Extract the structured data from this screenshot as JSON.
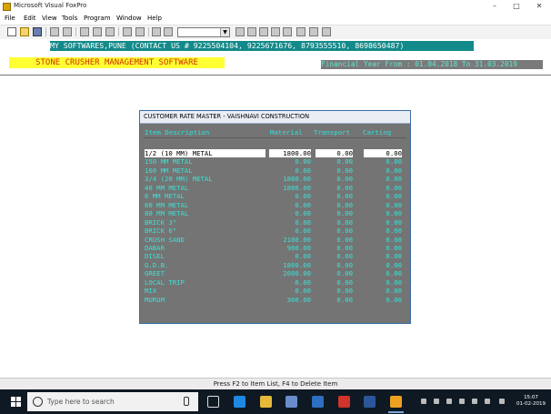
{
  "window": {
    "title": "Microsoft Visual FoxPro",
    "minimize": "–",
    "maximize": "□",
    "close": "✕"
  },
  "menu": [
    "File",
    "Edit",
    "View",
    "Tools",
    "Program",
    "Window",
    "Help"
  ],
  "header": {
    "contact": "MY SOFTWARES,PUNE (CONTACT US # 9225504104, 9225671676, 8793555510, 8698650487)",
    "app_name": "STONE CRUSHER MANAGEMENT SOFTWARE",
    "financial_year": "Financial Year From : 01.04.2018 To 31.03.2019"
  },
  "dialog": {
    "title": "CUSTOMER RATE MASTER - VAISHNAVI CONSTRUCTION",
    "columns": [
      "Item Description",
      "Material",
      "Transport",
      "Carting"
    ],
    "rows": [
      [
        "1/2 (10 MM) METAL",
        "1800.00",
        "0.00",
        "0.00"
      ],
      [
        "150 MM METAL",
        "0.00",
        "0.00",
        "0.00"
      ],
      [
        "160 MM METAL",
        "0.00",
        "0.00",
        "0.00"
      ],
      [
        "3/4 (20 MM) METAL",
        "1800.00",
        "0.00",
        "0.00"
      ],
      [
        "40 MM METAL",
        "1800.00",
        "0.00",
        "0.00"
      ],
      [
        "6 MM METAL",
        "0.00",
        "0.00",
        "0.00"
      ],
      [
        "60 MM METAL",
        "0.00",
        "0.00",
        "0.00"
      ],
      [
        "80 MM METAL",
        "0.00",
        "0.00",
        "0.00"
      ],
      [
        "BRICK 3\"",
        "0.00",
        "0.00",
        "0.00"
      ],
      [
        "BRICK 6\"",
        "0.00",
        "0.00",
        "0.00"
      ],
      [
        "CRUSH SAND",
        "2100.00",
        "0.00",
        "0.00"
      ],
      [
        "DABAR",
        "900.00",
        "0.00",
        "0.00"
      ],
      [
        "DISEL",
        "0.00",
        "0.00",
        "0.00"
      ],
      [
        "G.D.B.",
        "1800.00",
        "0.00",
        "0.00"
      ],
      [
        "GREET",
        "2000.00",
        "0.00",
        "0.00"
      ],
      [
        "LOCAL TRIP",
        "0.00",
        "0.00",
        "0.00"
      ],
      [
        "MIX",
        "0.00",
        "0.00",
        "0.00"
      ],
      [
        "MURUM",
        "300.00",
        "0.00",
        "0.00"
      ]
    ]
  },
  "status_bar": "Press F2 to Item List, F4 to Delete Item",
  "taskbar": {
    "search_placeholder": "Type here to search",
    "time": "15:07",
    "date": "01-02-2019"
  },
  "colors": {
    "contact_bg": "#138a8a",
    "app_name_bg": "#ffff33",
    "app_name_fg": "#d03000",
    "grid_text": "#38e2d6",
    "dialog_bg": "#747474"
  }
}
